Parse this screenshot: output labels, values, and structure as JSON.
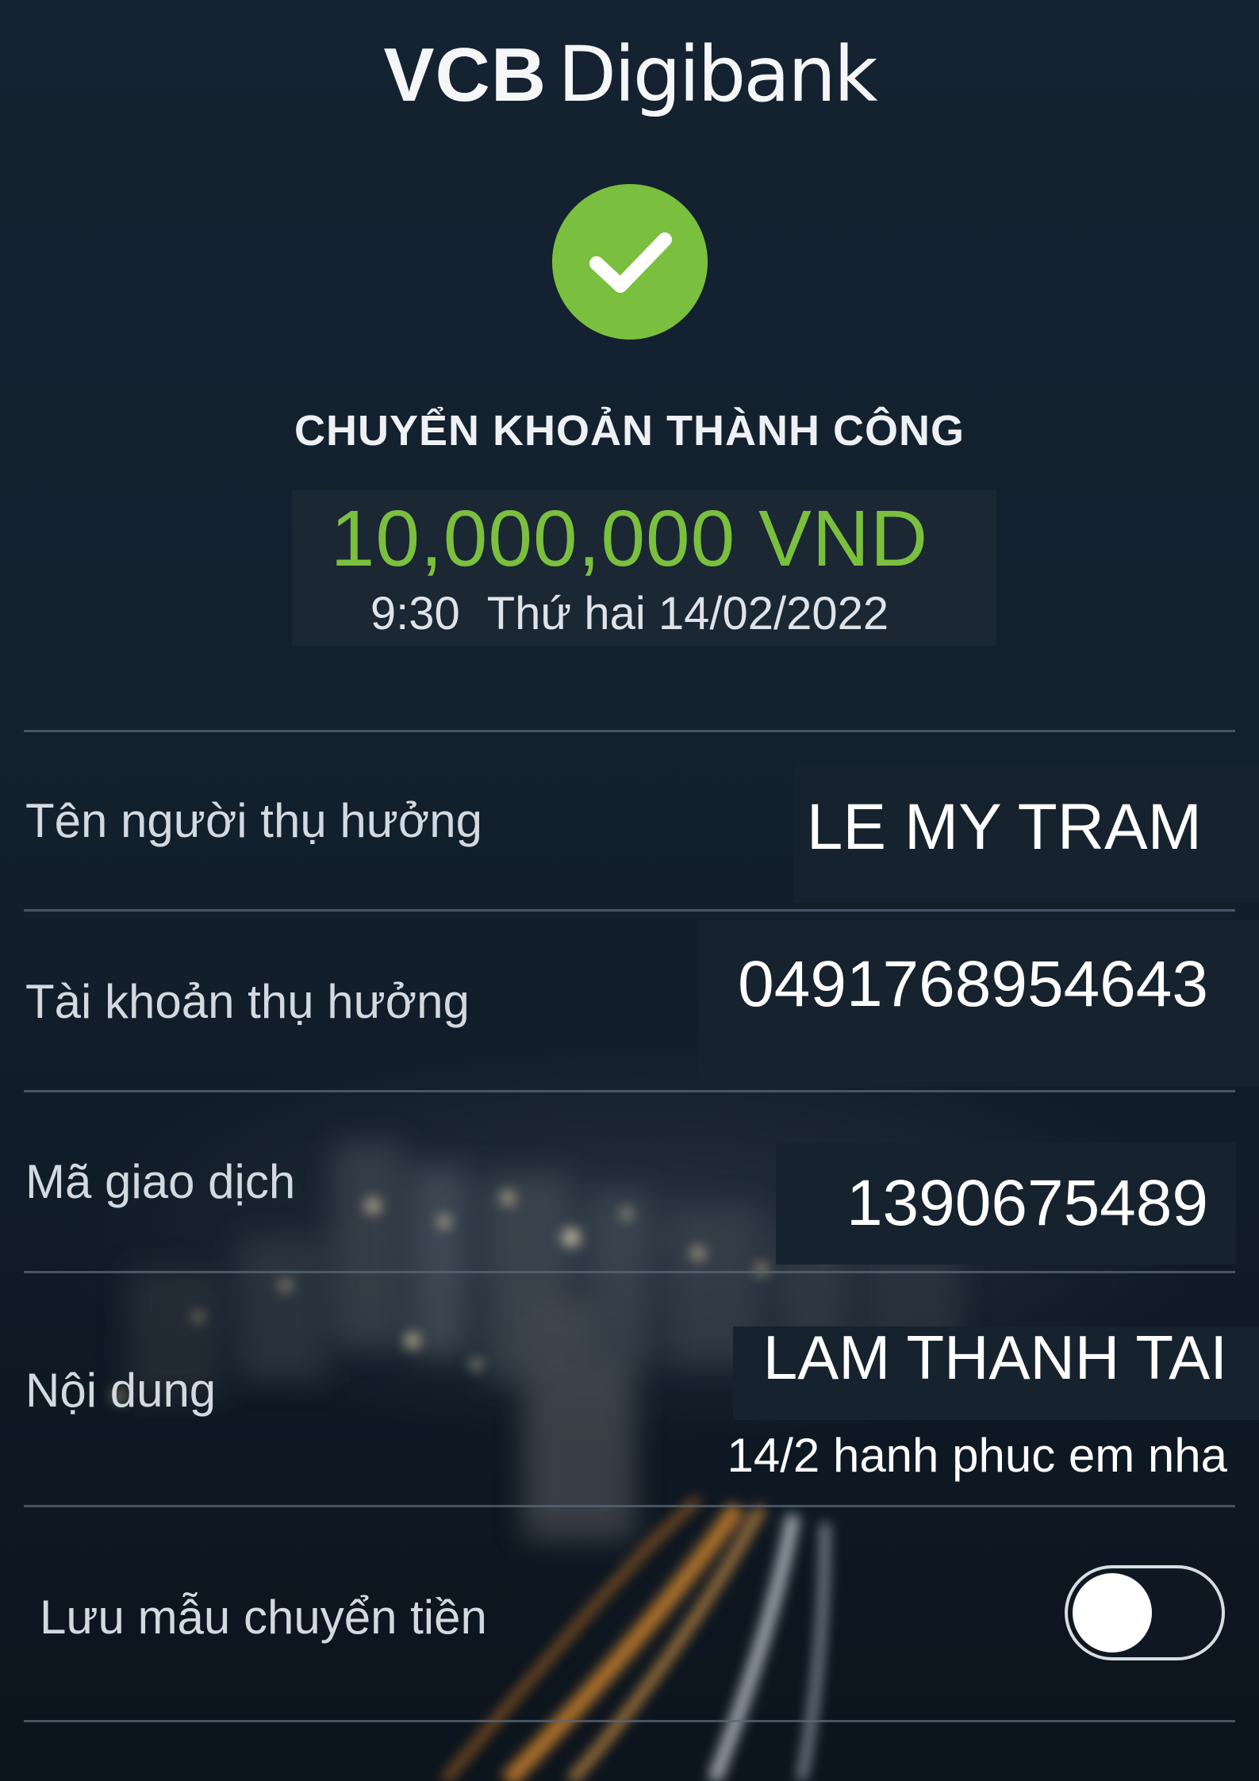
{
  "header": {
    "logo_part1": "VCB",
    "logo_part2": "Digibank"
  },
  "status": {
    "icon": "checkmark-icon",
    "title": "CHUYỂN KHOẢN THÀNH CÔNG",
    "amount": "10,000,000 VND",
    "time": "9:30",
    "date": "Thứ hai 14/02/2022"
  },
  "details": {
    "beneficiary_name_label": "Tên người thụ hưởng",
    "beneficiary_name": "LE MY TRAM",
    "beneficiary_account_label": "Tài khoản thụ hưởng",
    "beneficiary_account": "0491768954643",
    "transaction_code_label": "Mã giao dịch",
    "transaction_code": "1390675489",
    "content_label": "Nội dung",
    "content_line1": "LAM THANH TAI",
    "content_line2": "14/2 hanh phuc em nha"
  },
  "save_template": {
    "label": "Lưu mẫu chuyển tiền",
    "enabled": false
  },
  "colors": {
    "accent_green": "#7bbf3e",
    "background": "#13202e",
    "text": "#ffffff"
  }
}
